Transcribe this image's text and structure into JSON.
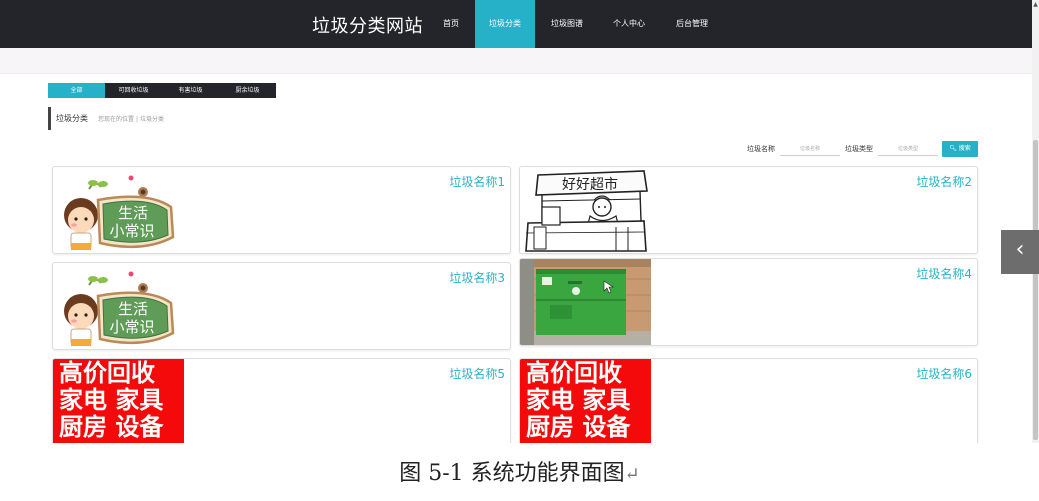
{
  "site": {
    "title": "垃圾分类网站"
  },
  "nav": {
    "items": [
      {
        "label": "首页"
      },
      {
        "label": "垃圾分类"
      },
      {
        "label": "垃圾图谱"
      },
      {
        "label": "个人中心"
      },
      {
        "label": "后台管理"
      }
    ],
    "active_index": 1
  },
  "tabs": {
    "items": [
      {
        "label": "全部"
      },
      {
        "label": "可回收垃圾"
      },
      {
        "label": "有害垃圾"
      },
      {
        "label": "厨余垃圾"
      }
    ],
    "active_index": 0
  },
  "breadcrumb": {
    "title": "垃圾分类",
    "path_prefix": "您现在的位置",
    "path_current": "垃圾分类"
  },
  "search": {
    "name_label": "垃圾名称",
    "name_placeholder": "垃圾名称",
    "type_label": "垃圾类型",
    "type_placeholder": "垃圾类型",
    "button_label": "搜索"
  },
  "cards": [
    {
      "name": "垃圾名称1",
      "image": "cartoon-daily-tips"
    },
    {
      "name": "垃圾名称2",
      "image": "sketch-convenience-store"
    },
    {
      "name": "垃圾名称3",
      "image": "cartoon-daily-tips"
    },
    {
      "name": "垃圾名称4",
      "image": "green-recycling-bin-photo"
    },
    {
      "name": "垃圾名称5",
      "image": "red-recycling-ad"
    },
    {
      "name": "垃圾名称6",
      "image": "red-recycling-ad"
    }
  ],
  "image_text": {
    "cartoon": [
      "生活",
      "小常识"
    ],
    "sketch_sign": "好好超市",
    "ad_lines": [
      "高价回收",
      "家电 家具",
      "厨房 设备"
    ]
  },
  "colors": {
    "accent": "#27b1c8",
    "nav_bg": "#23252a",
    "card_title": "#2ab3c7",
    "ad_red": "#f40a0a"
  },
  "caption": {
    "text": "图 5-1 系统功能界面图",
    "return_mark": "↵"
  }
}
